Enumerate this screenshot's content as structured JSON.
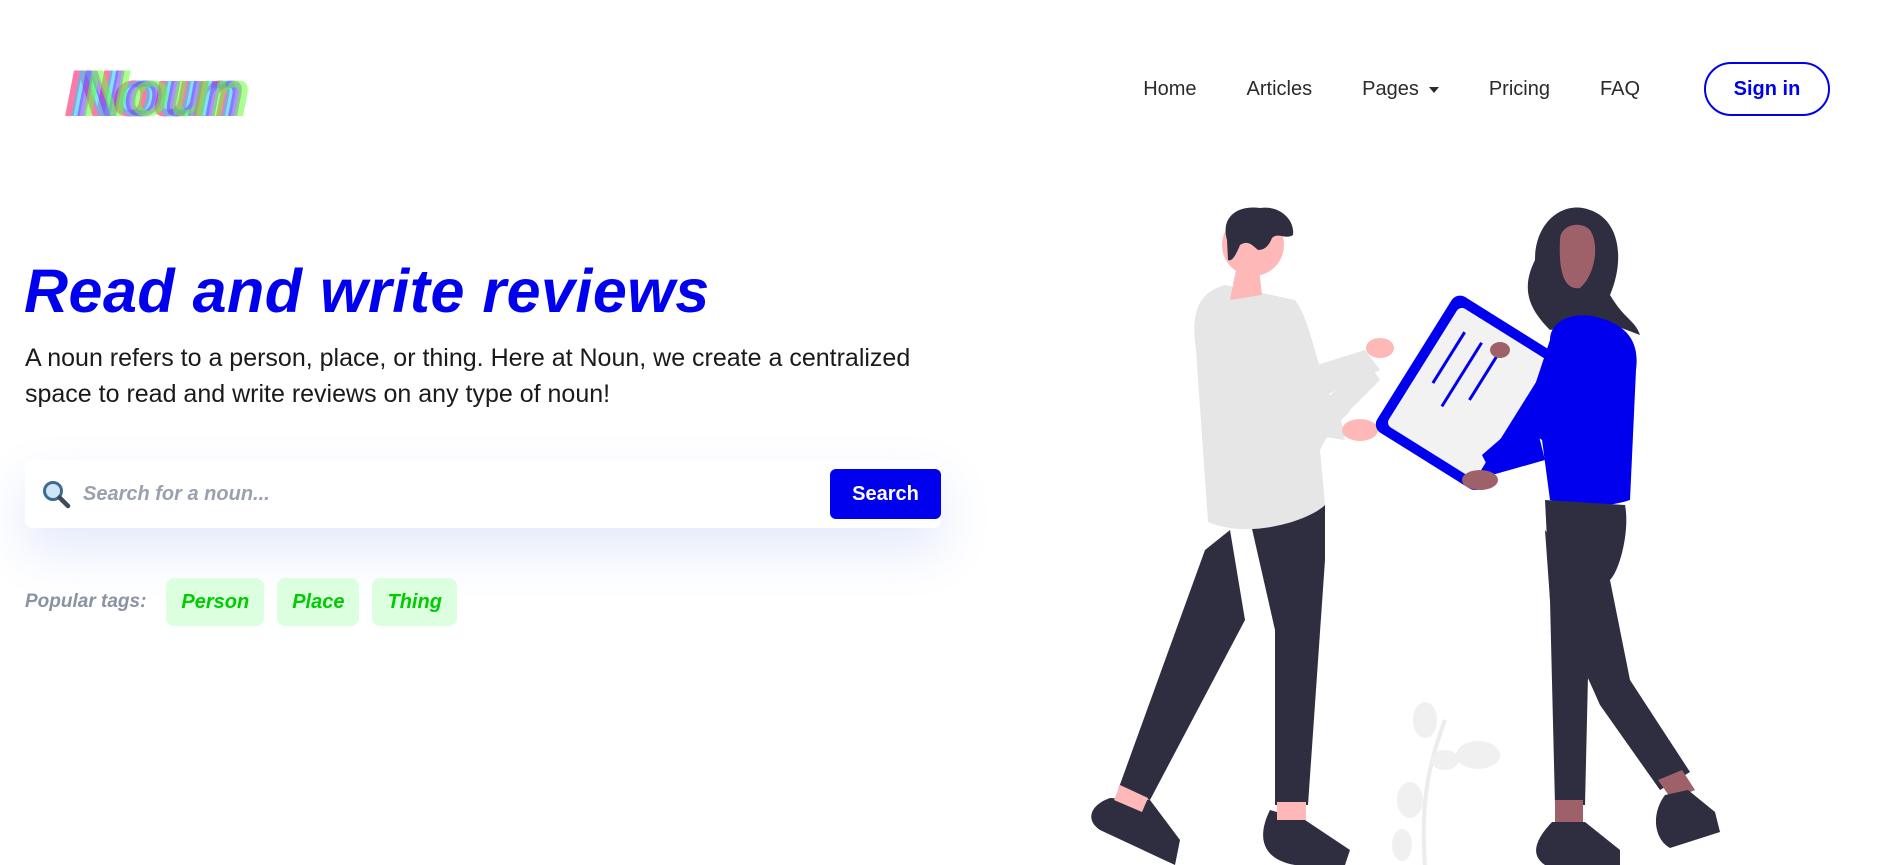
{
  "logo": {
    "text": "Noun"
  },
  "nav": {
    "items": [
      {
        "label": "Home"
      },
      {
        "label": "Articles"
      },
      {
        "label": "Pages"
      },
      {
        "label": "Pricing"
      },
      {
        "label": "FAQ"
      }
    ],
    "signin_label": "Sign in"
  },
  "hero": {
    "title": "Read and write reviews",
    "description": "A noun refers to a person, place, or thing. Here at Noun, we create a centralized space to read and write reviews on any type of noun!"
  },
  "search": {
    "placeholder": "Search for a noun...",
    "value": "",
    "button_label": "Search",
    "icon": "magnifier-icon"
  },
  "tags": {
    "label": "Popular tags:",
    "items": [
      {
        "label": "Person"
      },
      {
        "label": "Place"
      },
      {
        "label": "Thing"
      }
    ]
  },
  "colors": {
    "primary": "#0000ee",
    "tag_text": "#00cc00",
    "tag_bg": "#dcffe0",
    "muted": "#8a93a3",
    "pants": "#2f2e41"
  }
}
